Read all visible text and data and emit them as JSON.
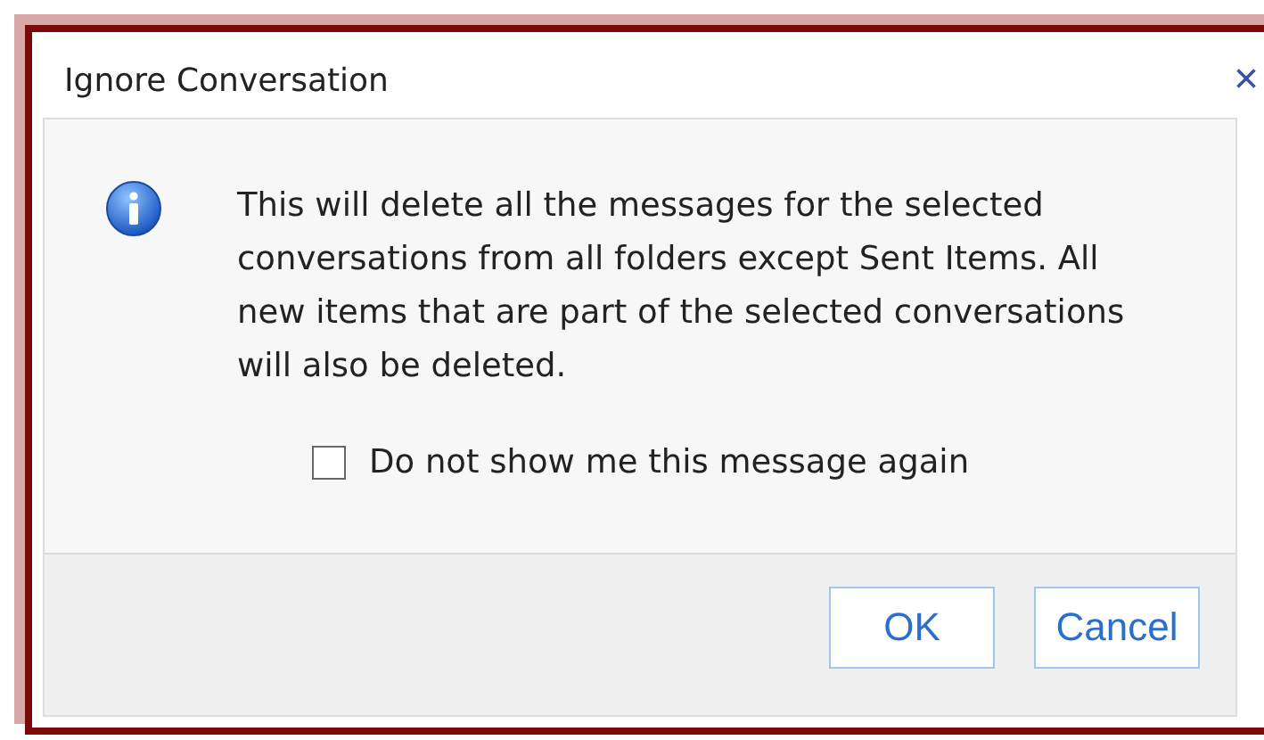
{
  "window": {
    "title": "Ignore Conversation",
    "close": "×"
  },
  "message": "This will delete all the messages for the selected conversations from all folders except Sent Items. All new items that are part of the selected conversations will also be deleted.",
  "checkbox": {
    "label": "Do not show me this message again",
    "checked": false
  },
  "buttons": [
    "OK",
    "Cancel"
  ]
}
